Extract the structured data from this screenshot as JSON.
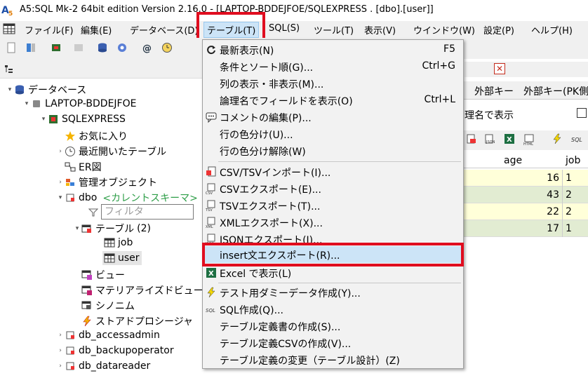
{
  "window": {
    "title": "A5:SQL Mk-2 64bit edition Version 2.16.0 - [LAPTOP-BDDEJFOE/SQLEXPRESS . [dbo].[user]]"
  },
  "menubar": [
    {
      "label": "ファイル(F)"
    },
    {
      "label": "編集(E)"
    },
    {
      "label": "データベース(D)"
    },
    {
      "label": "テーブル(T)"
    },
    {
      "label": "SQL(S)"
    },
    {
      "label": "ツール(T)"
    },
    {
      "label": "表示(V)"
    },
    {
      "label": "ウインドウ(W)"
    },
    {
      "label": "設定(P)"
    },
    {
      "label": "ヘルプ(H)"
    }
  ],
  "tree": {
    "root": "データベース",
    "server": "LAPTOP-BDDEJFOE",
    "instance": "SQLEXPRESS",
    "favorites": "お気に入り",
    "recent": "最近開いたテーブル",
    "er": "ER図",
    "admin": "管理オブジェクト",
    "dbo": "dbo",
    "dbo_current": "<カレントスキーマ>",
    "filter_placeholder": "フィルタ",
    "tables": "テーブル",
    "tables_count": "(2)",
    "table_job": "job",
    "table_user": "user",
    "views": "ビュー",
    "mviews": "マテリアライズドビュー",
    "synonyms": "シノニム",
    "procs": "ストアドプロシージャ",
    "schema1": "db_accessadmin",
    "schema2": "db_backupoperator",
    "schema3": "db_datareader"
  },
  "right": {
    "tab_fk": "外部キー",
    "tab_fk_pk": "外部キー(PK側",
    "logical_label": "理名で表示",
    "col_age": "age",
    "col_job": "job",
    "rows": [
      {
        "age": "16",
        "job": "1"
      },
      {
        "age": "43",
        "job": "2"
      },
      {
        "age": "22",
        "job": "2"
      },
      {
        "age": "17",
        "job": "1"
      }
    ]
  },
  "dropdown": {
    "items": [
      {
        "label": "最新表示(N)",
        "shortcut": "F5"
      },
      {
        "label": "条件とソート順(G)...",
        "shortcut": "Ctrl+G"
      },
      {
        "label": "列の表示・非表示(M)...",
        "shortcut": ""
      },
      {
        "label": "論理名でフィールドを表示(O)",
        "shortcut": "Ctrl+L"
      },
      {
        "label": "コメントの編集(P)...",
        "shortcut": ""
      },
      {
        "label": "行の色分け(U)...",
        "shortcut": ""
      },
      {
        "label": "行の色分け解除(W)",
        "shortcut": ""
      },
      {
        "label": "CSV/TSVインポート(I)...",
        "shortcut": ""
      },
      {
        "label": "CSVエクスポート(E)...",
        "shortcut": ""
      },
      {
        "label": "TSVエクスポート(T)...",
        "shortcut": ""
      },
      {
        "label": "XMLエクスポート(X)...",
        "shortcut": ""
      },
      {
        "label": "JSONエクスポート(J)...",
        "shortcut": ""
      },
      {
        "label": "insert文エクスポート(R)...",
        "shortcut": ""
      },
      {
        "label": "Excel で表示(L)",
        "shortcut": ""
      },
      {
        "label": "テスト用ダミーデータ作成(Y)...",
        "shortcut": ""
      },
      {
        "label": "SQL作成(Q)...",
        "shortcut": ""
      },
      {
        "label": "テーブル定義書の作成(S)...",
        "shortcut": ""
      },
      {
        "label": "テーブル定義CSVの作成(V)...",
        "shortcut": ""
      },
      {
        "label": "テーブル定義の変更（テーブル設計）(Z)",
        "shortcut": ""
      }
    ]
  }
}
